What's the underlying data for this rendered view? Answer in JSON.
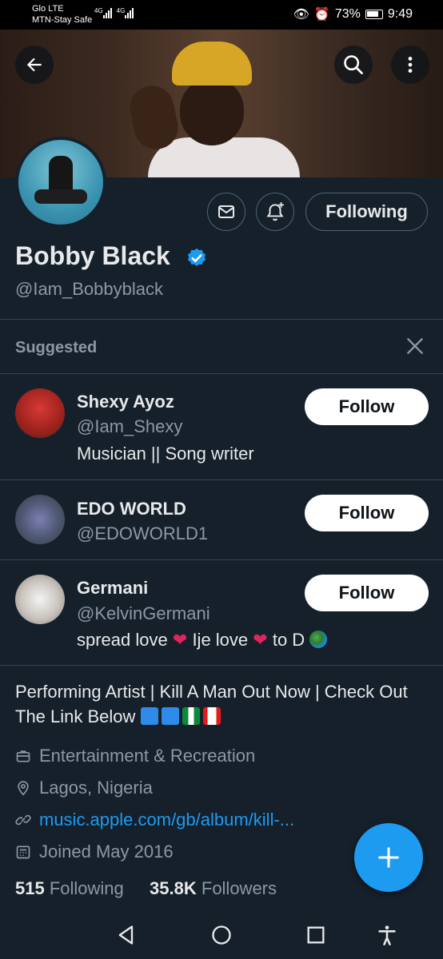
{
  "status_bar": {
    "carrier_line1": "Glo LTE",
    "carrier_line2": "MTN-Stay Safe",
    "signal1": "4G",
    "signal2": "4G",
    "battery": "73%",
    "time": "9:49"
  },
  "header": {
    "back_icon": "arrow-left-icon",
    "search_icon": "search-icon",
    "more_icon": "more-vertical-icon"
  },
  "profile": {
    "name": "Bobby Black",
    "handle": "@Iam_Bobbyblack",
    "following_button": "Following",
    "verified": true,
    "bio": "Performing Artist | Kill A Man Out Now  | Check Out The Link Below",
    "category": "Entertainment & Recreation",
    "location": "Lagos, Nigeria",
    "link": "music.apple.com/gb/album/kill-...",
    "joined": "Joined May 2016",
    "following_count": "515",
    "following_label": "Following",
    "followers_count": "35.8K",
    "followers_label": "Followers"
  },
  "suggested": {
    "title": "Suggested",
    "users": [
      {
        "name": "Shexy Ayoz",
        "handle": "@Iam_Shexy",
        "bio": "Musician || Song writer",
        "button": "Follow"
      },
      {
        "name": "EDO WORLD",
        "handle": "@EDOWORLD1",
        "bio": "",
        "button": "Follow"
      },
      {
        "name": "Germani",
        "handle": "@KelvinGermani",
        "bio_part1": "spread love",
        "bio_part2": "Ije love",
        "bio_part3": "to D",
        "button": "Follow"
      }
    ]
  },
  "colors": {
    "background": "#15202b",
    "accent": "#1d9bf0",
    "muted": "#8b98a5",
    "divider": "#38444d"
  }
}
